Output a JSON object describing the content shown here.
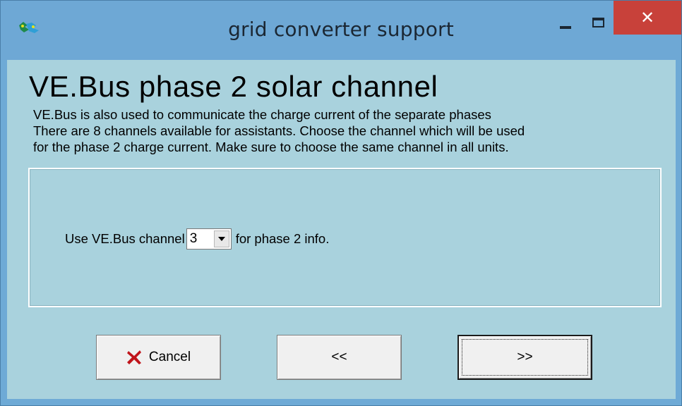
{
  "window": {
    "title": "grid converter support",
    "app_icon": "victron-app-icon",
    "controls": {
      "minimize_icon": "minimize-icon",
      "maximize_icon": "maximize-icon",
      "close_label": "✕"
    }
  },
  "page": {
    "heading": "VE.Bus phase 2 solar channel",
    "description": [
      "VE.Bus is also used to communicate the charge current of the separate phases",
      "There are 8 channels available for assistants. Choose the channel which will be used",
      "for the phase 2 charge current. Make sure to choose the same channel in all units."
    ]
  },
  "channel_row": {
    "prefix": "Use VE.Bus channel",
    "selected_value": "3",
    "suffix": "for phase 2 info."
  },
  "buttons": {
    "cancel_label": "Cancel",
    "back_label": "<<",
    "next_label": ">>"
  },
  "colors": {
    "titlebar": "#6ea8d5",
    "client_bg": "#a9d2dd",
    "close_button": "#c8413a",
    "cancel_icon": "#c0141a"
  }
}
